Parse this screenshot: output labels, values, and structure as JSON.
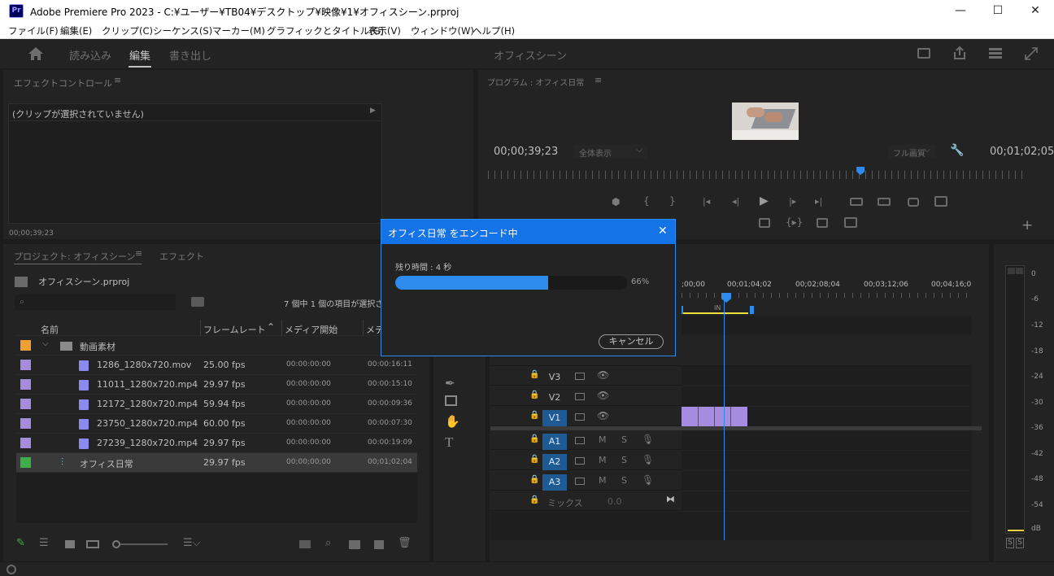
{
  "window": {
    "title": "Adobe Premiere Pro 2023 - C:¥ユーザー¥TB04¥デスクトップ¥映像¥1¥オフィスシーン.prproj",
    "app_badge": "Pr",
    "minimize": "—",
    "maximize": "☐",
    "close": "✕"
  },
  "menu": [
    "ファイル(F)",
    "編集(E)",
    "クリップ(C)",
    "シーケンス(S)",
    "マーカー(M)",
    "グラフィックとタイトル(G)",
    "表示(V)",
    "ウィンドウ(W)",
    "ヘルプ(H)"
  ],
  "workspace": {
    "tabs": [
      "読み込み",
      "編集",
      "書き出し"
    ],
    "active_tab": "編集",
    "center_title": "オフィスシーン"
  },
  "effect_controls": {
    "title": "エフェクトコントロール",
    "no_clip": "(クリップが選択されていません)",
    "timecode": "00;00;39;23"
  },
  "program_monitor": {
    "title": "プログラム : オフィス日常",
    "current_time": "00;00;39;23",
    "zoom": "全体表示",
    "quality": "フル画質",
    "duration": "00;01;02;05",
    "playhead_fraction": 0.69
  },
  "project": {
    "tab_active": "プロジェクト: オフィスシーン",
    "tab_other": "エフェクト",
    "file": "オフィスシーン.prproj",
    "count": "7 個中 1 個の項目が選択さ",
    "columns": [
      "名前",
      "フレームレート",
      "メディア開始",
      "メデ"
    ],
    "bin": "動画素材",
    "items": [
      {
        "name": "1286_1280x720.mov",
        "fps": "25.00 fps",
        "start": "00:00:00:00",
        "end": "00:00:16:11"
      },
      {
        "name": "11011_1280x720.mp4",
        "fps": "29.97 fps",
        "start": "00:00:00:00",
        "end": "00:00:15:10"
      },
      {
        "name": "12172_1280x720.mp4",
        "fps": "59.94 fps",
        "start": "00:00:00:00",
        "end": "00:00:09:36"
      },
      {
        "name": "23750_1280x720.mp4",
        "fps": "60.00 fps",
        "start": "00:00:00:00",
        "end": "00:00:07:30"
      },
      {
        "name": "27239_1280x720.mp4",
        "fps": "29.97 fps",
        "start": "00:00:00:00",
        "end": "00:00:19:09"
      }
    ],
    "sequence": {
      "name": "オフィス日常",
      "fps": "29.97 fps",
      "start": "00;00;00;00",
      "end": "00;01;02;04"
    }
  },
  "timeline": {
    "ruler": [
      ";00;00",
      "00;01;04;02",
      "00;02;08;04",
      "00;03;12;06",
      "00;04;16;0"
    ],
    "video_tracks": [
      "V3",
      "V2",
      "V1"
    ],
    "audio_tracks": [
      "A1",
      "A2",
      "A3"
    ],
    "mute": "M",
    "solo": "S",
    "mix_label": "ミックス",
    "mix_value": "0.0"
  },
  "audio_meter": {
    "scale": [
      "0",
      "-6",
      "-12",
      "-18",
      "-24",
      "-30",
      "-36",
      "-42",
      "-48",
      "-54",
      "dB"
    ],
    "solo": [
      "S",
      "S"
    ]
  },
  "dialog": {
    "title": "オフィス日常 をエンコード中",
    "remaining": "残り時間 : 4 秒",
    "progress_percent": 66,
    "progress_label": "66%",
    "cancel": "キャンセル",
    "close": "✕"
  },
  "colors": {
    "accent": "#2d8ceb",
    "dialog_header": "#1473e6",
    "bin_label": "#f0a030",
    "clip_label": "#a68ce0",
    "sequence_label": "#3dae4a"
  }
}
